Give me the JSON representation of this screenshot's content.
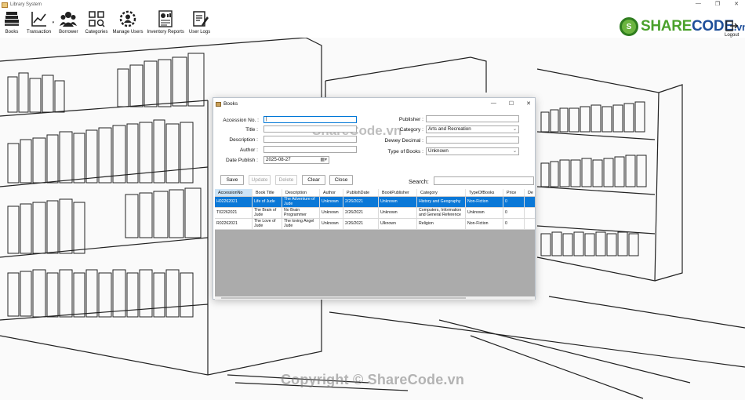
{
  "window": {
    "title": "Library System"
  },
  "toolbar": {
    "items": [
      {
        "label": "Books",
        "icon": "books-icon"
      },
      {
        "label": "Transaction",
        "icon": "chart-icon"
      },
      {
        "label": "Borrower",
        "icon": "users-icon"
      },
      {
        "label": "Categories",
        "icon": "categories-icon"
      },
      {
        "label": "Manage Users",
        "icon": "gear-user-icon"
      },
      {
        "label": "Inventory Reports",
        "icon": "report-icon"
      },
      {
        "label": "User Logs",
        "icon": "log-icon"
      }
    ],
    "logout_label": "Logout"
  },
  "brand": {
    "name_a": "SHARE",
    "name_b": "CODE",
    "suffix": ".vn"
  },
  "watermark": "Copyright © ShareCode.vn",
  "dialog_watermark": "ShareCode.vn",
  "dialog": {
    "title": "Books",
    "labels": {
      "accession": "Accession No. :",
      "title": "Title :",
      "description": "Description :",
      "author": "Author :",
      "date_publish": "Date Publish :",
      "publisher": "Publisher :",
      "category": "Category :",
      "dewey": "Dewey Decimal :",
      "type": "Type of Books :",
      "search": "Search:"
    },
    "values": {
      "date_publish": "2025-08-27",
      "category": "Arts and Recreation",
      "type": "Unknown"
    },
    "buttons": {
      "save": "Save",
      "update": "Update",
      "delete": "Delete",
      "clear": "Clear",
      "close": "Close"
    },
    "columns": [
      "AccessionNo",
      "Book Title",
      "Description",
      "Author",
      "PublishDate",
      "BookPublisher",
      "Category",
      "TypeOfBooks",
      "Price",
      "De"
    ],
    "rows": [
      [
        "H02262021",
        "Life of Jude",
        "The Adventure of Jude",
        "Unknown",
        "2/26/2021",
        "Unknown",
        "History and Geography",
        "Non-Fiction",
        "0",
        ""
      ],
      [
        "T02262021",
        "The Brain of Jude",
        "No Brain Programmer",
        "Unknown",
        "2/26/2021",
        "Unknown",
        "Computers, Information and General Reference",
        "Unknown",
        "0",
        ""
      ],
      [
        "R02262021",
        "The Love of Jude",
        "The loving Angel Jude",
        "Unknown",
        "2/26/2021",
        "Ulknown",
        "Religion",
        "Non-Fiction",
        "0",
        ""
      ]
    ]
  },
  "colors": {
    "selection": "#0a78d7",
    "grid_empty": "#ababab",
    "brand_blue": "#1f4f9a",
    "brand_green": "#4aa12b"
  }
}
